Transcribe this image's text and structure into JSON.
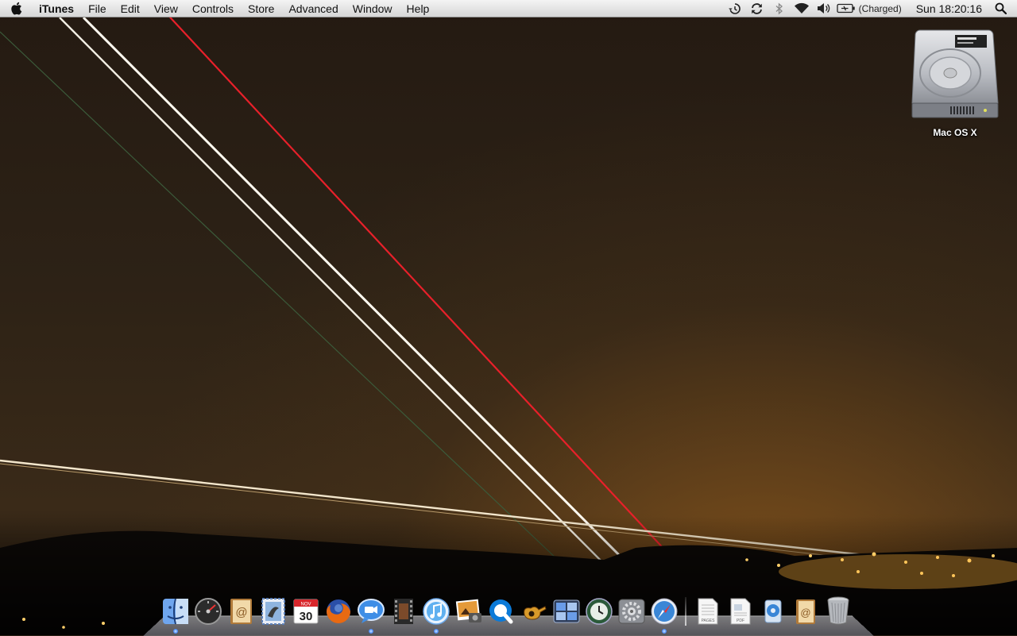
{
  "menubar": {
    "app_name": "iTunes",
    "menus": [
      "File",
      "Edit",
      "View",
      "Controls",
      "Store",
      "Advanced",
      "Window",
      "Help"
    ],
    "status_icons": [
      "time-machine-icon",
      "sync-icon",
      "bluetooth-icon",
      "wifi-icon",
      "volume-icon",
      "battery-icon"
    ],
    "battery_text": "(Charged)",
    "clock": "Sun 18:20:16"
  },
  "desktop": {
    "icons": [
      {
        "label": "Mac OS X",
        "icon": "hard-drive-icon"
      }
    ]
  },
  "dock": {
    "apps": [
      {
        "name": "finder-icon",
        "running": true
      },
      {
        "name": "dashboard-icon",
        "running": false
      },
      {
        "name": "address-book-icon",
        "running": false
      },
      {
        "name": "mail-icon",
        "running": false
      },
      {
        "name": "ical-icon",
        "date": "30",
        "month": "NOV",
        "running": false
      },
      {
        "name": "firefox-icon",
        "running": false
      },
      {
        "name": "ichat-icon",
        "running": true
      },
      {
        "name": "imovie-icon",
        "running": false
      },
      {
        "name": "itunes-icon",
        "running": true
      },
      {
        "name": "iphoto-icon",
        "running": false
      },
      {
        "name": "quicktime-icon",
        "running": false
      },
      {
        "name": "garageband-icon",
        "running": false
      },
      {
        "name": "spaces-icon",
        "running": false
      },
      {
        "name": "time-machine-icon",
        "running": false
      },
      {
        "name": "system-preferences-icon",
        "running": false
      },
      {
        "name": "safari-icon",
        "running": true
      }
    ],
    "docs": [
      {
        "name": "pages-document-icon",
        "label": "PAGES"
      },
      {
        "name": "pdf-document-icon",
        "label": "PDF"
      },
      {
        "name": "downloads-stack-icon"
      },
      {
        "name": "mail-stack-icon"
      },
      {
        "name": "trash-icon"
      }
    ]
  }
}
